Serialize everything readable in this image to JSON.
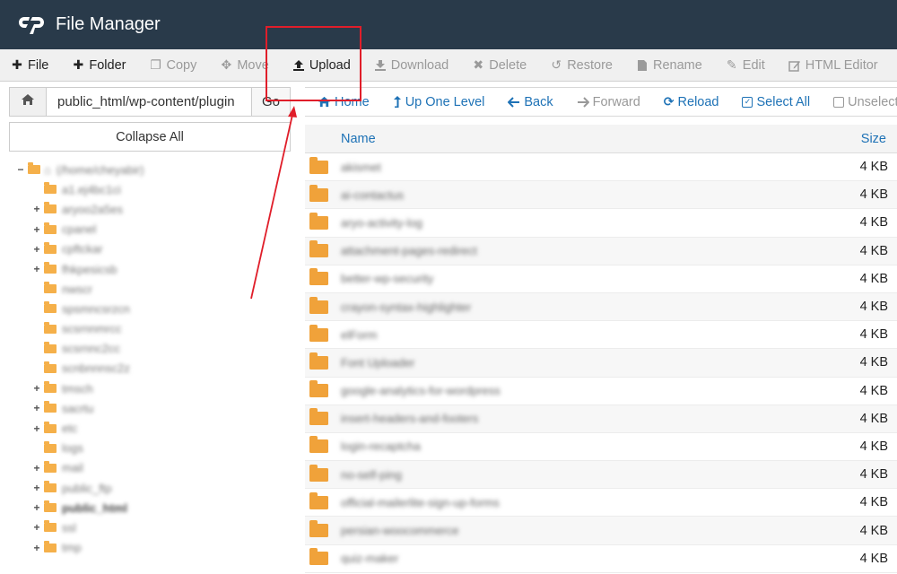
{
  "header": {
    "app_title": "File Manager",
    "brand_color": "#293a4a",
    "logo_text": "cP"
  },
  "toolbar": {
    "items": [
      {
        "label": "File",
        "icon": "plus-icon",
        "enabled": true
      },
      {
        "label": "Folder",
        "icon": "plus-icon",
        "enabled": true
      },
      {
        "label": "Copy",
        "icon": "copy-icon",
        "enabled": false
      },
      {
        "label": "Move",
        "icon": "move-arrows-icon",
        "enabled": false
      },
      {
        "label": "Upload",
        "icon": "upload-icon",
        "enabled": true
      },
      {
        "label": "Download",
        "icon": "download-icon",
        "enabled": false
      },
      {
        "label": "Delete",
        "icon": "x-icon",
        "enabled": false
      },
      {
        "label": "Restore",
        "icon": "undo-icon",
        "enabled": false
      },
      {
        "label": "Rename",
        "icon": "file-icon",
        "enabled": false
      },
      {
        "label": "Edit",
        "icon": "pencil-icon",
        "enabled": false
      },
      {
        "label": "HTML Editor",
        "icon": "edit-square-icon",
        "enabled": false
      }
    ]
  },
  "path_bar": {
    "value": "public_html/wp-content/plugin",
    "go_label": "Go"
  },
  "sidebar": {
    "collapse_label": "Collapse All",
    "root_label": "(/home/cheyabir)",
    "items": [
      {
        "label": "a1.ej4bc1ci",
        "expandable": false
      },
      {
        "label": "aryoo2a5es",
        "expandable": true
      },
      {
        "label": "cpanel",
        "expandable": true
      },
      {
        "label": "cpftckar",
        "expandable": true
      },
      {
        "label": "fhkpesicsb",
        "expandable": true
      },
      {
        "label": "nwscr",
        "expandable": false
      },
      {
        "label": "spsmncsrzcn",
        "expandable": false
      },
      {
        "label": "scsrnnmrcc",
        "expandable": false
      },
      {
        "label": "scsrnnc2cc",
        "expandable": false
      },
      {
        "label": "scnbnnnsc2z",
        "expandable": false
      },
      {
        "label": "tmsch",
        "expandable": true
      },
      {
        "label": "sacrtu",
        "expandable": true
      },
      {
        "label": "etc",
        "expandable": true
      },
      {
        "label": "logs",
        "expandable": false
      },
      {
        "label": "mail",
        "expandable": true
      },
      {
        "label": "public_ftp",
        "expandable": true
      },
      {
        "label": "public_html",
        "expandable": true,
        "bold": true
      },
      {
        "label": "ssl",
        "expandable": true
      },
      {
        "label": "tmp",
        "expandable": true
      }
    ]
  },
  "nav": {
    "home": "Home",
    "up": "Up One Level",
    "back": "Back",
    "forward": "Forward",
    "reload": "Reload",
    "select_all": "Select All",
    "unselect": "Unselect"
  },
  "table": {
    "columns": {
      "name": "Name",
      "size": "Size"
    },
    "rows": [
      {
        "name": "akismet",
        "size": "4 KB"
      },
      {
        "name": "ai-contactus",
        "size": "4 KB"
      },
      {
        "name": "aryo-activity-log",
        "size": "4 KB"
      },
      {
        "name": "attachment-pages-redirect",
        "size": "4 KB"
      },
      {
        "name": "better-wp-security",
        "size": "4 KB"
      },
      {
        "name": "crayon-syntax-highlighter",
        "size": "4 KB"
      },
      {
        "name": "elForm",
        "size": "4 KB"
      },
      {
        "name": "Font Uploader",
        "size": "4 KB"
      },
      {
        "name": "google-analytics-for-wordpress",
        "size": "4 KB"
      },
      {
        "name": "insert-headers-and-footers",
        "size": "4 KB"
      },
      {
        "name": "login-recaptcha",
        "size": "4 KB"
      },
      {
        "name": "no-self-ping",
        "size": "4 KB"
      },
      {
        "name": "official-mailerlite-sign-up-forms",
        "size": "4 KB"
      },
      {
        "name": "persian-woocommerce",
        "size": "4 KB"
      },
      {
        "name": "quiz-maker",
        "size": "4 KB"
      }
    ]
  },
  "colors": {
    "link": "#1e72b6",
    "folder": "#f0a23a",
    "annotation": "#e01e2a"
  }
}
